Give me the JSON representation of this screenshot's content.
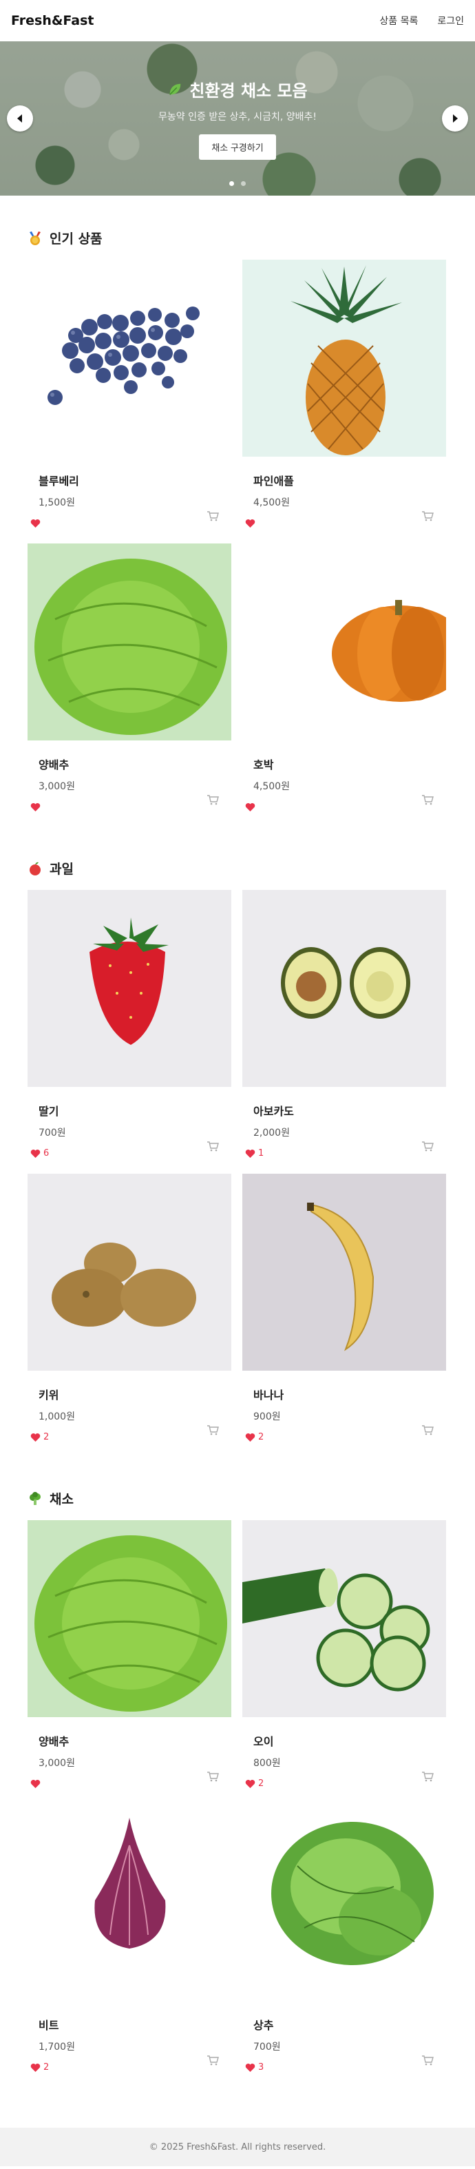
{
  "header": {
    "logo": "Fresh&Fast",
    "nav": [
      "상품 목록",
      "로그인"
    ]
  },
  "hero": {
    "title": "친환경 채소 모음",
    "subtitle": "무농약 인증 받은 상추, 시금치, 양배추!",
    "button": "채소 구경하기",
    "slide_count": 2,
    "active_slide": 1
  },
  "sections": [
    {
      "title": "인기 상품",
      "icon": "medal-icon",
      "products": [
        {
          "name": "블루베리",
          "price": "1,500원",
          "likes": ""
        },
        {
          "name": "파인애플",
          "price": "4,500원",
          "likes": ""
        },
        {
          "name": "양배추",
          "price": "3,000원",
          "likes": ""
        },
        {
          "name": "호박",
          "price": "4,500원",
          "likes": ""
        }
      ]
    },
    {
      "title": "과일",
      "icon": "apple-icon",
      "products": [
        {
          "name": "딸기",
          "price": "700원",
          "likes": "6"
        },
        {
          "name": "아보카도",
          "price": "2,000원",
          "likes": "1"
        },
        {
          "name": "키위",
          "price": "1,000원",
          "likes": "2"
        },
        {
          "name": "바나나",
          "price": "900원",
          "likes": "2"
        }
      ]
    },
    {
      "title": "채소",
      "icon": "broccoli-icon",
      "products": [
        {
          "name": "양배추",
          "price": "3,000원",
          "likes": ""
        },
        {
          "name": "오이",
          "price": "800원",
          "likes": "2"
        },
        {
          "name": "비트",
          "price": "1,700원",
          "likes": "2"
        },
        {
          "name": "상추",
          "price": "700원",
          "likes": "3"
        }
      ]
    }
  ],
  "footer": "© 2025 Fresh&Fast. All rights reserved.",
  "colors": {
    "heart": "#e8334a",
    "footer_bg": "#f2f2f2"
  }
}
